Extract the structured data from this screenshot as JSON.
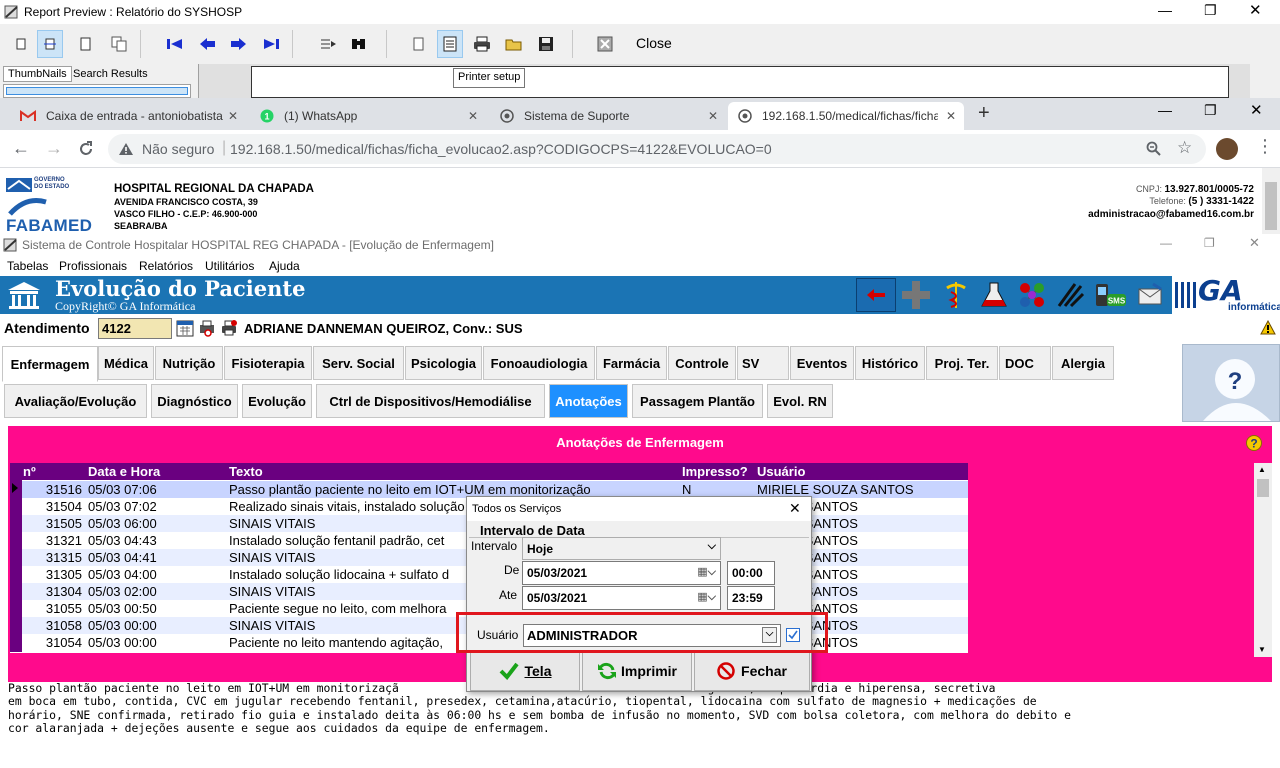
{
  "report_window": {
    "title": "Report Preview : Relatório do SYSHOSP",
    "close_label": "Close",
    "thumbnails_tab": "ThumbNails",
    "search_tab": "Search Results",
    "tooltip": "Printer setup",
    "icons": [
      "single-page-icon",
      "page-width-icon",
      "full-page-icon",
      "multi-page-icon",
      "first-page-icon",
      "prev-page-icon",
      "next-page-icon",
      "last-page-icon",
      "goto-page-icon",
      "find-icon",
      "page-setup-icon",
      "printer-setup-icon",
      "print-icon",
      "open-icon",
      "save-icon",
      "close-doc-icon"
    ]
  },
  "browser": {
    "tabs": [
      {
        "title": "Caixa de entrada - antoniobatista",
        "icon": "gmail-icon"
      },
      {
        "title": "(1) WhatsApp",
        "icon": "whatsapp-icon"
      },
      {
        "title": "Sistema de Suporte",
        "icon": "globe-icon"
      },
      {
        "title": "192.168.1.50/medical/fichas/ficha",
        "icon": "globe-icon"
      }
    ],
    "security_label": "Não seguro",
    "url": "192.168.1.50/medical/fichas/ficha_evolucao2.asp?CODIGOCPS=4122&EVOLUCAO=0"
  },
  "hospital": {
    "gov_label": "GOVERNO DO ESTADO",
    "brand": "FABAMED",
    "name": "HOSPITAL REGIONAL DA CHAPADA",
    "address1": "AVENIDA FRANCISCO COSTA, 39",
    "address2": "VASCO FILHO - C.E.P: 46.900-000",
    "address3": "SEABRA/BA",
    "cnpj_label": "CNPJ:",
    "cnpj": "13.927.801/0005-72",
    "phone_label": "Telefone:",
    "phone": "(5 ) 3331-1422",
    "email": "administracao@fabamed16.com.br"
  },
  "app": {
    "title": "Sistema de Controle Hospitalar HOSPITAL REG CHAPADA - [Evolução de Enfermagem]",
    "menu": [
      "Tabelas",
      "Profissionais",
      "Relatórios",
      "Utilitários",
      "Ajuda"
    ],
    "banner_title": "Evolução do Paciente",
    "banner_copy": "CopyRight© GA Informática",
    "banner_brand": "GA",
    "banner_brand_sub": "informática",
    "sms_label": "SMS"
  },
  "atendimento": {
    "label": "Atendimento",
    "value": "4122",
    "patient": "ADRIANE DANNEMAN QUEIROZ, Conv.: SUS"
  },
  "main_tabs": [
    "Enfermagem",
    "Médica",
    "Nutrição",
    "Fisioterapia",
    "Serv. Social",
    "Psicologia",
    "Fonoaudiologia",
    "Farmácia",
    "Controle",
    "SV",
    "Eventos",
    "Histórico",
    "Proj. Ter.",
    "DOC",
    "Alergia"
  ],
  "sub_tabs": [
    "Avaliação/Evolução",
    "Diagnóstico",
    "Evolução",
    "Ctrl de Dispositivos/Hemodiálise",
    "Anotações",
    "Passagem Plantão",
    "Evol. RN"
  ],
  "section_title": "Anotações de Enfermagem",
  "grid": {
    "headers": [
      "nº",
      "Data e Hora",
      "Texto",
      "Impresso?",
      "Usuário"
    ],
    "rows": [
      {
        "n": "31516",
        "d": "05/03 07:06",
        "t": "Passo plantão paciente no leito em IOT+UM em monitorização",
        "i": "N",
        "u": "MIRIELE SOUZA SANTOS"
      },
      {
        "n": "31504",
        "d": "05/03 07:02",
        "t": "Realizado sinais vitais, instalado solução",
        "i": "",
        "u": "SOUZA SANTOS"
      },
      {
        "n": "31505",
        "d": "05/03 06:00",
        "t": "SINAIS VITAIS",
        "i": "",
        "u": "SOUZA SANTOS"
      },
      {
        "n": "31321",
        "d": "05/03 04:43",
        "t": "Instalado solução fentanil padrão, cet",
        "i": "",
        "u": "SOUZA SANTOS"
      },
      {
        "n": "31315",
        "d": "05/03 04:41",
        "t": "SINAIS VITAIS",
        "i": "",
        "u": "SOUZA SANTOS"
      },
      {
        "n": "31305",
        "d": "05/03 04:00",
        "t": "Instalado solução lidocaina + sulfato d",
        "i": "",
        "u": "SOUZA SANTOS"
      },
      {
        "n": "31304",
        "d": "05/03 02:00",
        "t": "SINAIS VITAIS",
        "i": "",
        "u": "SOUZA SANTOS"
      },
      {
        "n": "31055",
        "d": "05/03 00:50",
        "t": "Paciente segue no leito, com melhora",
        "i": "",
        "u": "SOUZA SANTOS"
      },
      {
        "n": "31058",
        "d": "05/03 00:00",
        "t": "SINAIS VITAIS",
        "i": "",
        "u": "SOUZA SANTOS"
      },
      {
        "n": "31054",
        "d": "05/03 00:00",
        "t": "Paciente no leito mantendo agitação,",
        "i": "",
        "u": "SOUZA SANTOS"
      }
    ]
  },
  "detail_text": "Passo plantão paciente no leito em IOT+UM em monitorizaçã                              iodo bastante agitada, taquicárdia e hiperensa, secretiva\nem boca em tubo, contida, CVC em jugular recebendo fentanil, presedex, cetamina,atacúrio, tiopental, lidocaina com sulfato de magnesio + medicações de\nhorário, SNE confirmada, retirado fio guia e instalado deita às 06:00 hs e sem bomba de infusão no momento, SVD com bolsa coletora, com melhora do debito e\ncor alaranjada + dejeções ausente e segue aos cuidados da equipe de enfermagem.",
  "dialog": {
    "title": "Todos os Serviços",
    "group": "Intervalo de Data",
    "interval_label": "Intervalo",
    "interval_value": "Hoje",
    "from_label": "De",
    "from_date": "05/03/2021",
    "from_time": "00:00",
    "to_label": "Ate",
    "to_date": "05/03/2021",
    "to_time": "23:59",
    "user_label": "Usuário",
    "user_value": "ADMINISTRADOR",
    "user_checked": true,
    "btn_tela": "Tela",
    "btn_imprimir": "Imprimir",
    "btn_fechar": "Fechar"
  },
  "colors": {
    "banner": "#1b74b4",
    "pink": "#ff0a8c",
    "purple": "#6a0080",
    "selected_row": "#c8d4ff",
    "active_subtab": "#1e90ff",
    "highlight_box": "#e0161e"
  }
}
